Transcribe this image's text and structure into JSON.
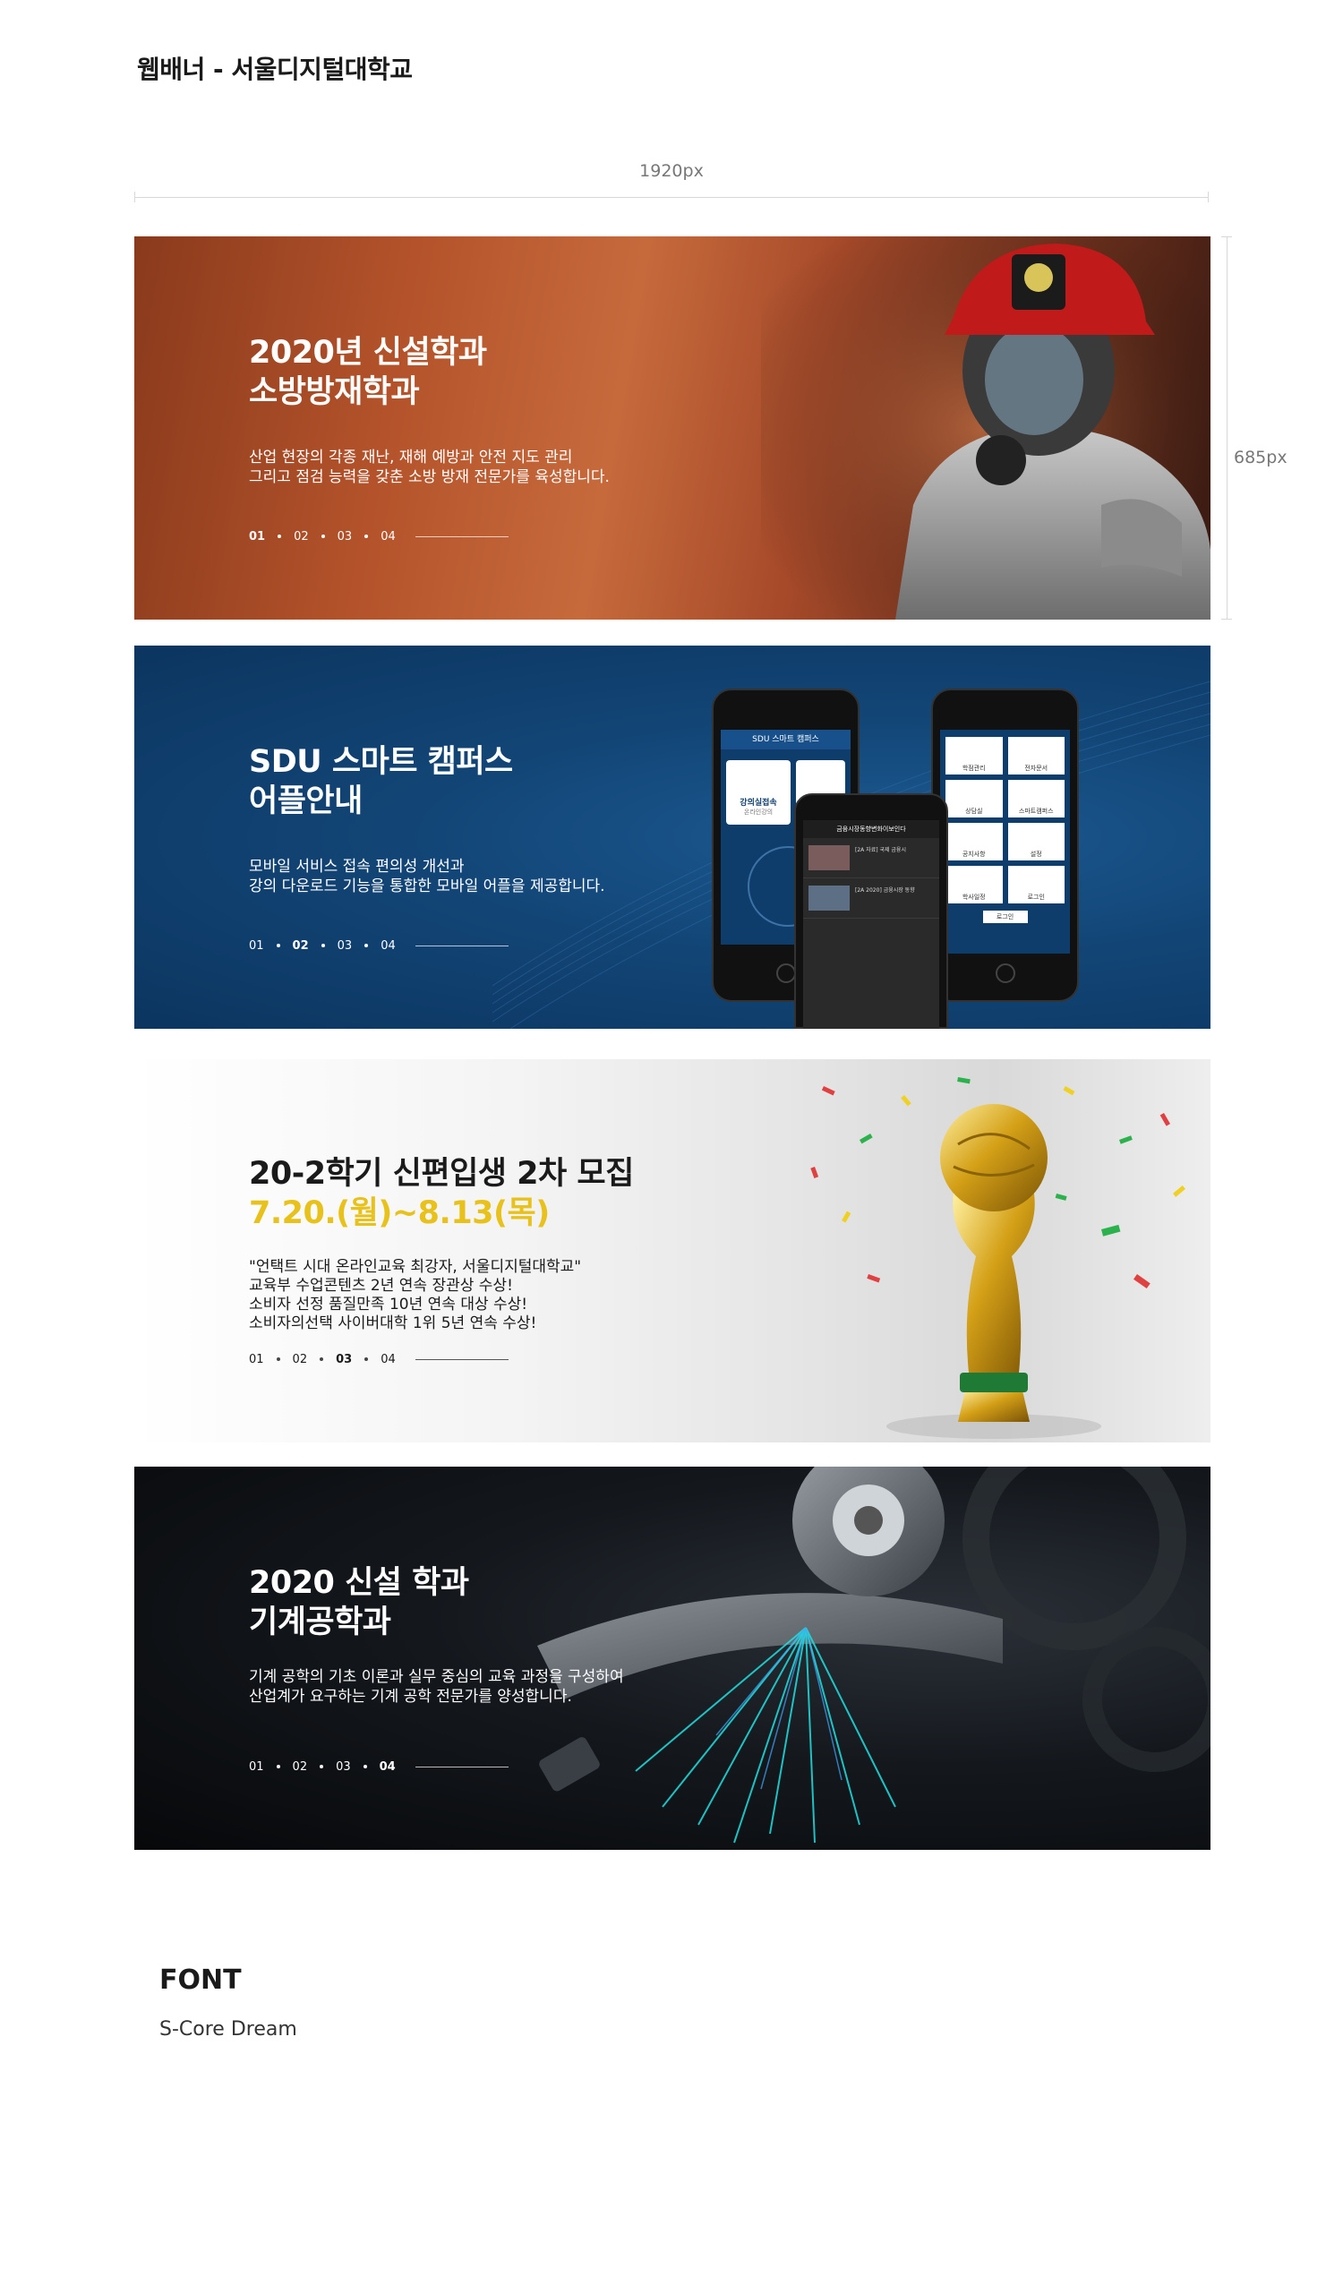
{
  "page": {
    "title": "웹배너 - 서울디지털대학교"
  },
  "dimensions": {
    "width_label": "1920px",
    "height_label": "685px"
  },
  "banners": [
    {
      "title": [
        "2020년 신설학과",
        "소방방재학과"
      ],
      "subtitle": [
        "산업 현장의 각종 재난, 재해 예방과 안전 지도 관리",
        "그리고 점검 능력을 갖춘 소방 방재 전문가를 육성합니다."
      ],
      "pager": [
        "01",
        "02",
        "03",
        "04"
      ],
      "active": 0
    },
    {
      "title": [
        "SDU 스마트 캠퍼스",
        "어플안내"
      ],
      "subtitle": [
        "모바일 서비스 접속 편의성 개선과",
        "강의 다운로드 기능을 통합한 모바일 어플을 제공합니다."
      ],
      "pager": [
        "01",
        "02",
        "03",
        "04"
      ],
      "active": 1,
      "phones": {
        "phone1": {
          "header": "SDU 스마트 캠퍼스",
          "tile": "강의실접속",
          "tile_sub": "온라인강의"
        },
        "phone2": {
          "header": "금융시장동향변화이보인다",
          "items": [
            "[2A 자료] 국제 금융시",
            "[2A 2020] 금융시장 동향"
          ]
        },
        "phone3": {
          "tiles": [
            "학점관리",
            "전자문서",
            "상담실",
            "스마트캠퍼스",
            "공지사항",
            "설정",
            "학사일정",
            "로그인"
          ],
          "login": "로그인"
        }
      }
    },
    {
      "title": [
        "20-2학기 신편입생 2차 모집"
      ],
      "highlight": "7.20.(월)~8.13(목)",
      "subtitle": [
        "\"언택트 시대 온라인교육 최강자, 서울디지털대학교\"",
        "교육부 수업콘텐츠 2년 연속 장관상 수상!",
        "소비자 선정 품질만족 10년 연속 대상 수상!",
        "소비자의선택 사이버대학 1위 5년 연속 수상!"
      ],
      "pager": [
        "01",
        "02",
        "03",
        "04"
      ],
      "active": 2
    },
    {
      "title": [
        "2020 신설 학과",
        "기계공학과"
      ],
      "subtitle": [
        "기계 공학의 기초 이론과 실무 중심의 교육 과정을 구성하여",
        "산업계가 요구하는 기계 공학 전문가를 양성합니다."
      ],
      "pager": [
        "01",
        "02",
        "03",
        "04"
      ],
      "active": 3
    }
  ],
  "font_section": {
    "heading": "FONT",
    "name": "S-Core Dream"
  }
}
